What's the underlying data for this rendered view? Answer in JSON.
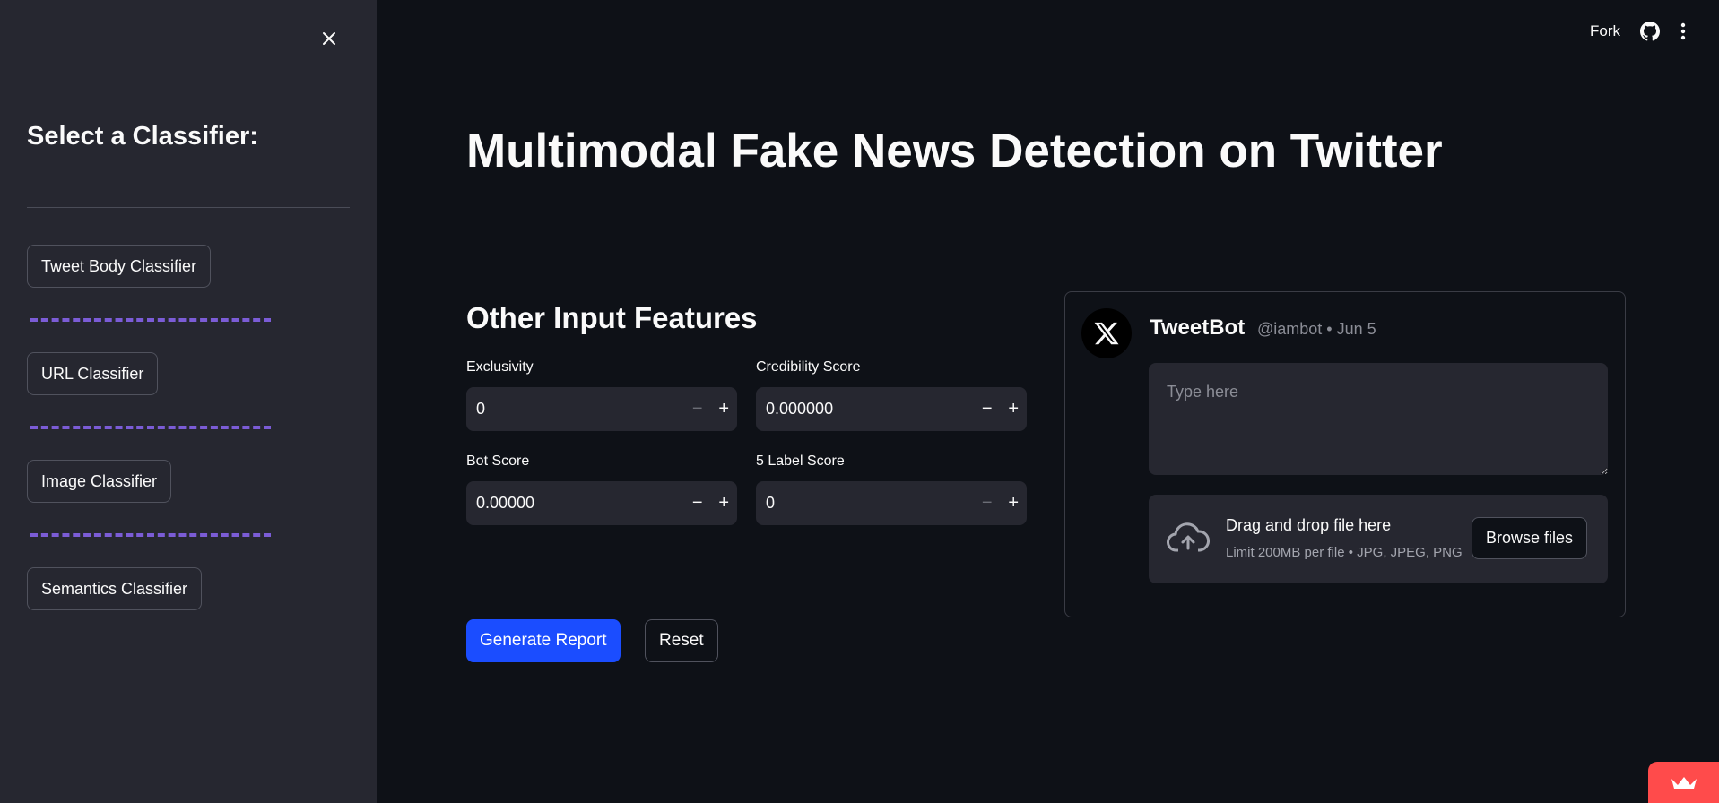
{
  "sidebar": {
    "title": "Select a Classifier:",
    "buttons": [
      "Tweet Body Classifier",
      "URL Classifier",
      "Image Classifier",
      "Semantics Classifier"
    ]
  },
  "header": {
    "fork_label": "Fork"
  },
  "main": {
    "title": "Multimodal Fake News Detection on Twitter",
    "subtitle": "Other Input Features",
    "fields": [
      {
        "label": "Exclusivity",
        "value": "0"
      },
      {
        "label": "Credibility Score",
        "value": "0.000000"
      },
      {
        "label": "Bot Score",
        "value": "0.00000"
      },
      {
        "label": "5 Label Score",
        "value": "0"
      }
    ],
    "generate_label": "Generate Report",
    "reset_label": "Reset"
  },
  "tweet": {
    "name": "TweetBot",
    "meta": "@iambot • Jun 5",
    "placeholder": "Type here",
    "upload_title": "Drag and drop file here",
    "upload_sub": "Limit 200MB per file • JPG, JPEG, PNG",
    "browse_label": "Browse files"
  },
  "icons": {
    "close": "close-icon",
    "github": "github-icon",
    "menu": "kebab-menu-icon",
    "x_logo": "x-logo-icon",
    "upload": "cloud-upload-icon",
    "crown": "crown-icon"
  },
  "colors": {
    "accent_blue": "#1b4dff",
    "dash_purple": "#7b5cd6",
    "badge_red": "#ff4b4b"
  }
}
